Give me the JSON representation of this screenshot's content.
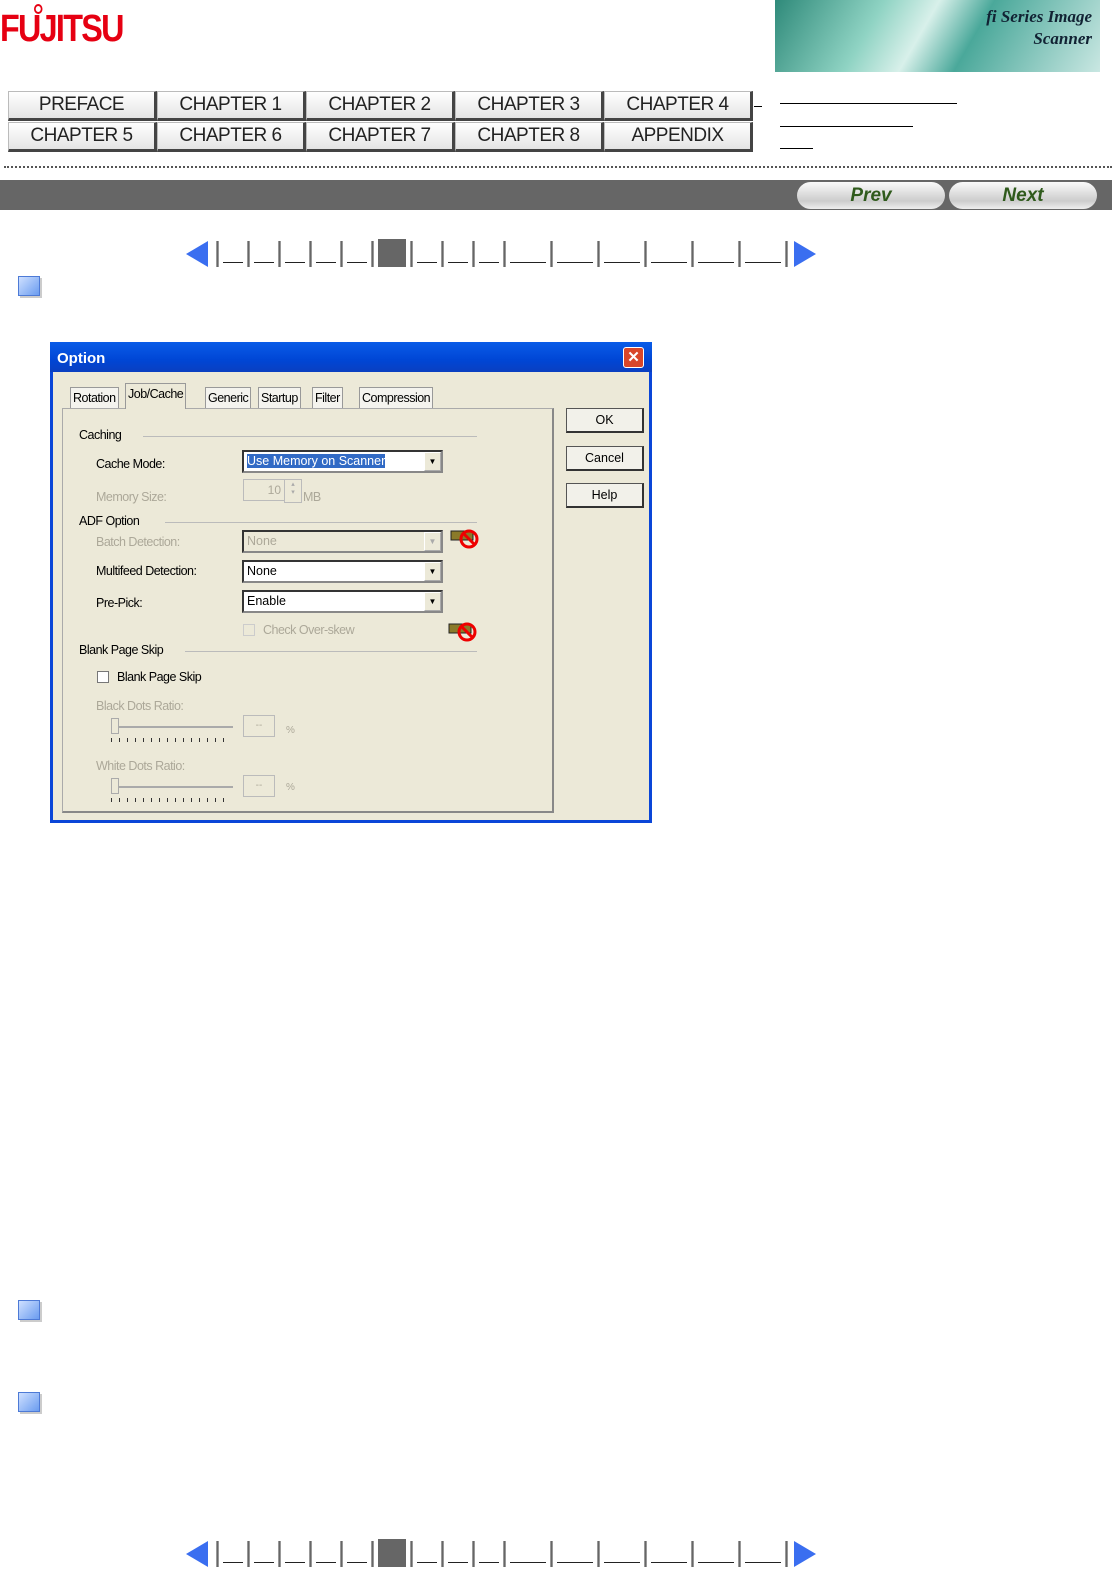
{
  "header": {
    "logo_text": "FUJITSU",
    "banner_text": "fi Series Image Scanner"
  },
  "nav": {
    "buttons": [
      "PREFACE",
      "CHAPTER 1",
      "CHAPTER 2",
      "CHAPTER 3",
      "CHAPTER 4",
      "CHAPTER 5",
      "CHAPTER 6",
      "CHAPTER 7",
      "CHAPTER 8",
      "APPENDIX"
    ]
  },
  "toolbar": {
    "prev": "Prev",
    "next": "Next"
  },
  "dialog": {
    "title": "Option",
    "close": "✕",
    "tabs": [
      "Rotation",
      "Job/Cache",
      "Generic",
      "Startup",
      "Filter",
      "Compression"
    ],
    "active_tab": "Job/Cache",
    "buttons": {
      "ok": "OK",
      "cancel": "Cancel",
      "help": "Help"
    },
    "caching": {
      "group": "Caching",
      "cache_mode_label": "Cache Mode:",
      "cache_mode_value": "Use Memory on Scanner",
      "memory_size_label": "Memory Size:",
      "memory_size_value": "10",
      "memory_unit": "MB"
    },
    "adf": {
      "group": "ADF Option",
      "batch_label": "Batch Detection:",
      "batch_value": "None",
      "multifeed_label": "Multifeed Detection:",
      "multifeed_value": "None",
      "prepick_label": "Pre-Pick:",
      "prepick_value": "Enable",
      "overskew_label": "Check Over-skew"
    },
    "blank": {
      "group": "Blank Page Skip",
      "checkbox_label": "Blank Page Skip",
      "black_label": "Black Dots Ratio:",
      "black_value": "--",
      "white_label": "White Dots Ratio:",
      "white_value": "--",
      "unit": "%"
    }
  },
  "colors": {
    "accent": "#0a46d8",
    "logo": "#e60012",
    "bar": "#666666"
  }
}
